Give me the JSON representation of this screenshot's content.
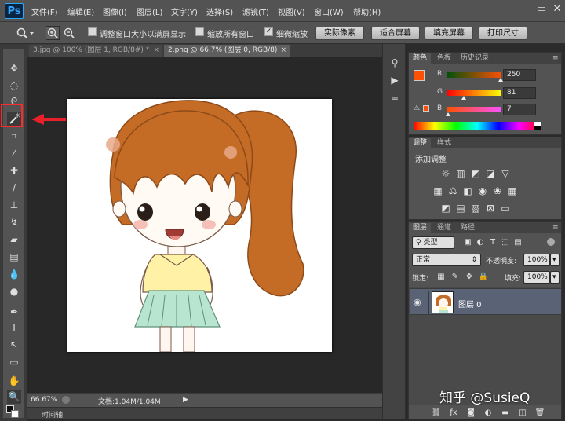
{
  "app": {
    "logo": "Ps"
  },
  "menu": {
    "items": [
      "文件(F)",
      "编辑(E)",
      "图像(I)",
      "图层(L)",
      "文字(Y)",
      "选择(S)",
      "滤镜(T)",
      "视图(V)",
      "窗口(W)",
      "帮助(H)"
    ]
  },
  "window_controls": {
    "minimize": "–",
    "restore": "▭",
    "close": "✕"
  },
  "options": {
    "resize_windows": "调整窗口大小以满屏显示",
    "zoom_all": "缩放所有窗口",
    "scrubby_zoom": "细微缩放",
    "buttons": [
      "实际像素",
      "适合屏幕",
      "填充屏幕",
      "打印尺寸"
    ]
  },
  "doc_tabs": [
    {
      "label": "3.jpg @ 100% (图层 1, RGB/8#) *",
      "close": "×",
      "active": false
    },
    {
      "label": "2.png @ 66.7% (图层 0, RGB/8)",
      "close": "×",
      "active": true
    }
  ],
  "status": {
    "zoom": "66.67%",
    "doc": "文档:1.04M/1.04M"
  },
  "timeline": {
    "label": "时间轴"
  },
  "color_panel": {
    "tabs": [
      "颜色",
      "色板",
      "历史记录"
    ],
    "r_label": "R",
    "g_label": "G",
    "b_label": "B",
    "r": "250",
    "g": "81",
    "b": "7",
    "foreground": "#fa5107",
    "r_level": 0.98,
    "g_level": 0.32,
    "b_level": 0.03
  },
  "adjustments_panel": {
    "tabs": [
      "调整",
      "样式"
    ],
    "title": "添加调整"
  },
  "layers_panel": {
    "tabs": [
      "图层",
      "通道",
      "路径"
    ],
    "filter_label": "类型",
    "blend_mode": "正常",
    "opacity_label": "不透明度:",
    "opacity": "100%",
    "lock_label": "锁定:",
    "fill_label": "填充:",
    "fill": "100%",
    "layer_name": "图层 0"
  },
  "watermark": "知乎 @SusieQ",
  "colors": {
    "accent_red": "#e8202a",
    "hair": "#c8702a",
    "skirt": "#b7e3cf",
    "blouse": "#fff1a8"
  }
}
